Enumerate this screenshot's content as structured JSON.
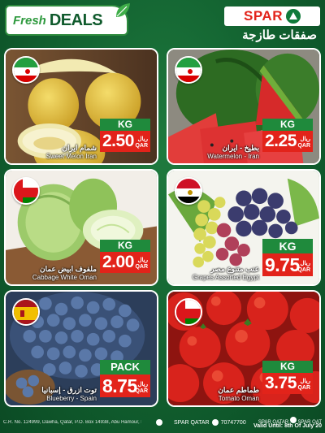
{
  "header": {
    "fresh_label": "Fresh",
    "deals_label": "DEALS",
    "brand": "SPAR",
    "arabic_title": "صفقات طازجة"
  },
  "products": [
    {
      "name_ar": "شمام ايران",
      "name_en": "Sweet Melon Iran",
      "unit": "KG",
      "price": "2.50",
      "currency_ar": "ريال",
      "currency": "QAR",
      "flag": "iran-flag-icon"
    },
    {
      "name_ar": "بطيخ - ايران",
      "name_en": "Watermelon - Iran",
      "unit": "KG",
      "price": "2.25",
      "currency_ar": "ريال",
      "currency": "QAR",
      "flag": "iran-flag-icon"
    },
    {
      "name_ar": "ملفوف ابيض عمان",
      "name_en": "Cabbage White Oman",
      "unit": "KG",
      "price": "2.00",
      "currency_ar": "ريال",
      "currency": "QAR",
      "flag": "oman-flag-icon"
    },
    {
      "name_ar": "عنب متنوع مصر",
      "name_en": "Grapes Assorted Egypt",
      "unit": "KG",
      "price": "9.75",
      "currency_ar": "ريال",
      "currency": "QAR",
      "flag": "egypt-flag-icon"
    },
    {
      "name_ar": "توت ازرق - إسبانيا",
      "name_en": "Blueberry - Spain",
      "unit": "PACK",
      "price": "8.75",
      "currency_ar": "ريال",
      "currency": "QAR",
      "flag": "spain-flag-icon"
    },
    {
      "name_ar": "طماطم عمان",
      "name_en": "Tomato Oman",
      "unit": "KG",
      "price": "3.75",
      "currency_ar": "ريال",
      "currency": "QAR",
      "flag": "oman-flag-icon"
    }
  ],
  "footer": {
    "address": "C.R. No. 124999, Dawha, Qatar, P.O. Box 14938, Abu Hamour, Doha - Qatar",
    "social_handle": "SPAR QATAR",
    "phone": "70747700",
    "handle_right_1": "SPAR QATAR",
    "handle_right_2": "SPAR QAT",
    "valid_text": "Valid Until: 8th Of July 20"
  },
  "colors": {
    "brand_green": "#0f5a2c",
    "price_red": "#e2231a",
    "unit_green": "#1f8a3c"
  }
}
